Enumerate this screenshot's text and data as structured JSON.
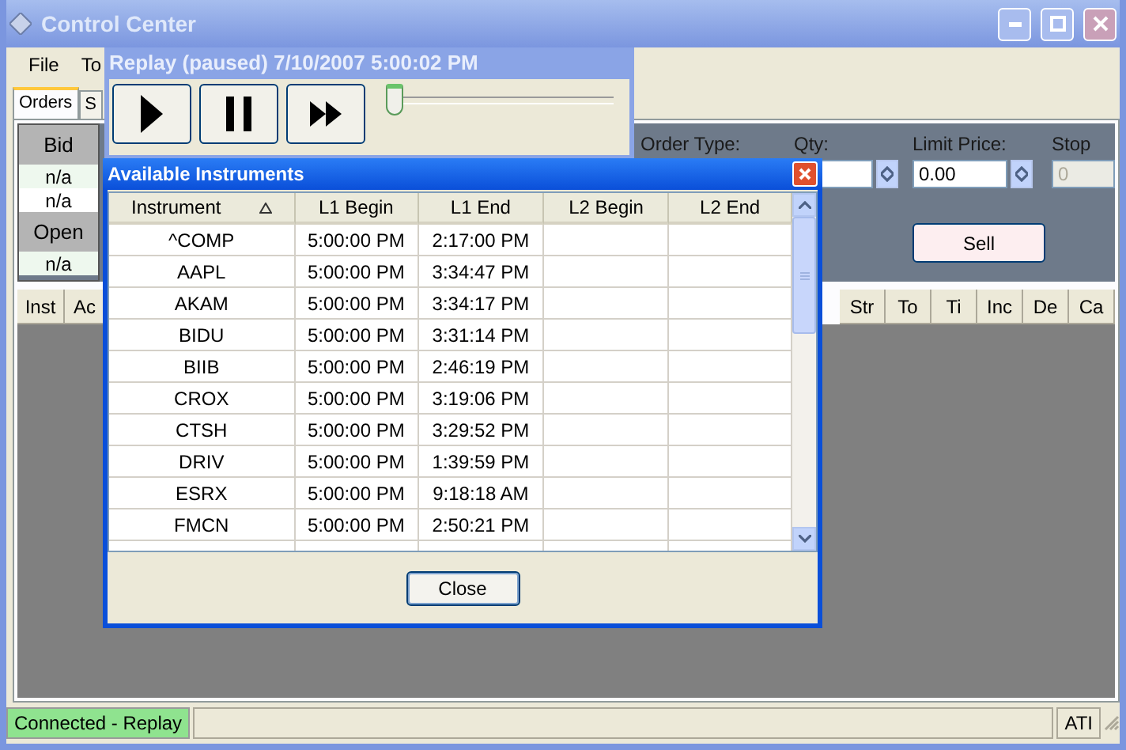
{
  "window": {
    "title": "Control Center"
  },
  "menu": [
    "File",
    "To"
  ],
  "tabs": [
    {
      "label": "Orders",
      "selected": true
    },
    {
      "label": "S",
      "selected": false
    }
  ],
  "quote_panel": [
    {
      "label": "Bid",
      "values": [
        "n/a",
        "n/a"
      ]
    },
    {
      "label": "Open",
      "values": [
        "n/a"
      ]
    }
  ],
  "order_form": [
    {
      "label": "Order Type:",
      "kind": "label"
    },
    {
      "label": "Qty:",
      "kind": "spin"
    },
    {
      "label": "Limit Price:",
      "kind": "spin",
      "value": "0.00"
    },
    {
      "label": "Stop",
      "kind": "text",
      "value": "0",
      "disabled": true
    }
  ],
  "sell_button": "Sell",
  "grid": {
    "columns_left": [
      "Inst",
      "Ac"
    ],
    "columns_right": [
      "Str",
      "To",
      "Ti",
      "Inc",
      "De",
      "Ca"
    ]
  },
  "status_bar": {
    "connection": "Connected - Replay",
    "indicator": "ATI"
  },
  "replay": {
    "title": "Replay (paused) 7/10/2007 5:00:02 PM",
    "buttons": [
      {
        "kind": "play"
      },
      {
        "kind": "pause"
      },
      {
        "kind": "fast_forward"
      }
    ],
    "position": {
      "level": 0
    }
  },
  "instruments": {
    "title": "Available Instruments",
    "columns": [
      {
        "label": "Instrument",
        "sorted": true
      },
      {
        "label": "L1 Begin",
        "sorted": false
      },
      {
        "label": "L1 End",
        "sorted": false
      },
      {
        "label": "L2 Begin",
        "sorted": false
      },
      {
        "label": "L2 End",
        "sorted": false
      }
    ],
    "rows": [
      [
        "^COMP",
        "5:00:00 PM",
        "2:17:00 PM"
      ],
      [
        "AAPL",
        "5:00:00 PM",
        "3:34:47 PM"
      ],
      [
        "AKAM",
        "5:00:00 PM",
        "3:34:17 PM"
      ],
      [
        "BIDU",
        "5:00:00 PM",
        "3:31:14 PM"
      ],
      [
        "BIIB",
        "5:00:00 PM",
        "2:46:19 PM"
      ],
      [
        "CROX",
        "5:00:00 PM",
        "3:19:06 PM"
      ],
      [
        "CTSH",
        "5:00:00 PM",
        "3:29:52 PM"
      ],
      [
        "DRIV",
        "5:00:00 PM",
        "1:39:59 PM"
      ],
      [
        "ESRX",
        "5:00:00 PM",
        "9:18:18 AM"
      ],
      [
        "FMCN",
        "5:00:00 PM",
        "2:50:21 PM"
      ]
    ],
    "close_button": "Close"
  }
}
